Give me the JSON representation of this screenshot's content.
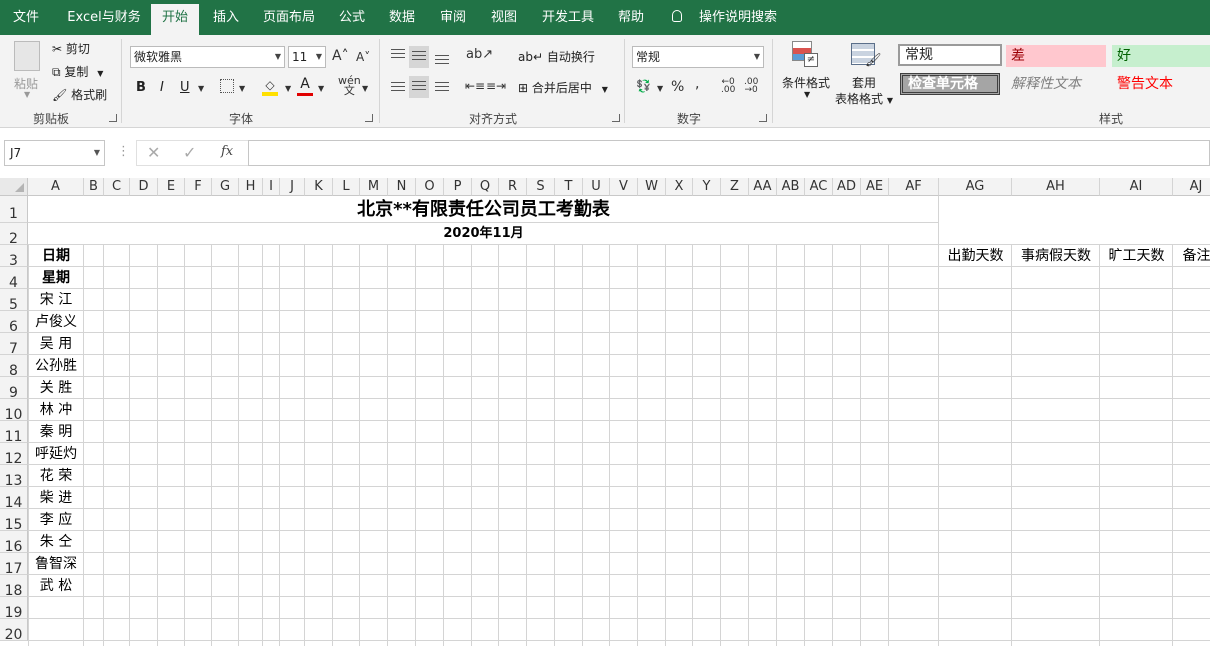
{
  "menu": [
    "文件",
    "Excel与财务",
    "开始",
    "插入",
    "页面布局",
    "公式",
    "数据",
    "审阅",
    "视图",
    "开发工具",
    "帮助",
    "操作说明搜索"
  ],
  "ribbon": {
    "clipboard": {
      "paste": "粘贴",
      "cut": "剪切",
      "copy": "复制",
      "format_painter": "格式刷",
      "label": "剪贴板"
    },
    "font": {
      "name": "微软雅黑",
      "size": "11",
      "bold": "B",
      "italic": "I",
      "underline": "U",
      "label": "字体"
    },
    "alignment": {
      "wrap": "自动换行",
      "merge": "合并后居中",
      "label": "对齐方式"
    },
    "number": {
      "format": "常规",
      "label": "数字"
    },
    "styles": {
      "conditional": "条件格式",
      "table_line1": "套用",
      "table_line2": "表格格式",
      "normal": "常规",
      "bad": "差",
      "good": "好",
      "check": "检查单元格",
      "explanatory": "解释性文本",
      "warning": "警告文本",
      "label": "样式"
    }
  },
  "formula_bar": {
    "cell_ref": "J7",
    "value": ""
  },
  "columns": [
    "A",
    "B",
    "C",
    "D",
    "E",
    "F",
    "G",
    "H",
    "I",
    "J",
    "K",
    "L",
    "M",
    "N",
    "O",
    "P",
    "Q",
    "R",
    "S",
    "T",
    "U",
    "V",
    "W",
    "X",
    "Y",
    "Z",
    "AA",
    "AB",
    "AC",
    "AD",
    "AE",
    "AF",
    "AG",
    "AH",
    "AI",
    "AJ"
  ],
  "rows": [
    "1",
    "2",
    "3",
    "4",
    "5",
    "6",
    "7",
    "8",
    "9",
    "10",
    "11",
    "12",
    "13",
    "14",
    "15",
    "16",
    "17",
    "18",
    "19",
    "20"
  ],
  "sheet": {
    "title": "北京**有限责任公司员工考勤表",
    "month": "2020年11月",
    "date_label": "日期",
    "week_label": "星期",
    "employees": [
      "宋 江",
      "卢俊义",
      "吴 用",
      "公孙胜",
      "关 胜",
      "林 冲",
      "秦 明",
      "呼延灼",
      "花 荣",
      "柴 进",
      "李 应",
      "朱 仝",
      "鲁智深",
      "武 松"
    ],
    "summary_headers": [
      "出勤天数",
      "事病假天数",
      "旷工天数",
      "备注"
    ]
  }
}
